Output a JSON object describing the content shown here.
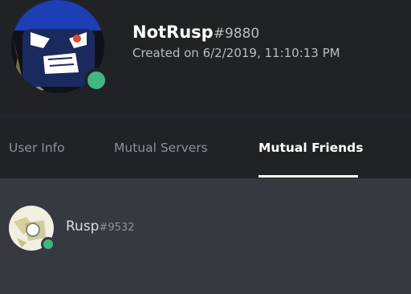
{
  "profile": {
    "username": "NotRusp",
    "discriminator": "#9880",
    "created": "Created on 6/2/2019, 11:10:13 PM",
    "status": "online",
    "status_color": "#43b581"
  },
  "tabs": [
    {
      "label": "User Info",
      "active": false
    },
    {
      "label": "Mutual Servers",
      "active": false
    },
    {
      "label": "Mutual Friends",
      "active": true
    }
  ],
  "mutual_friends": [
    {
      "username": "Rusp",
      "discriminator": "#9532",
      "status": "online"
    }
  ],
  "colors": {
    "header_bg": "#202225",
    "content_bg": "#36393f",
    "online": "#43b581"
  }
}
